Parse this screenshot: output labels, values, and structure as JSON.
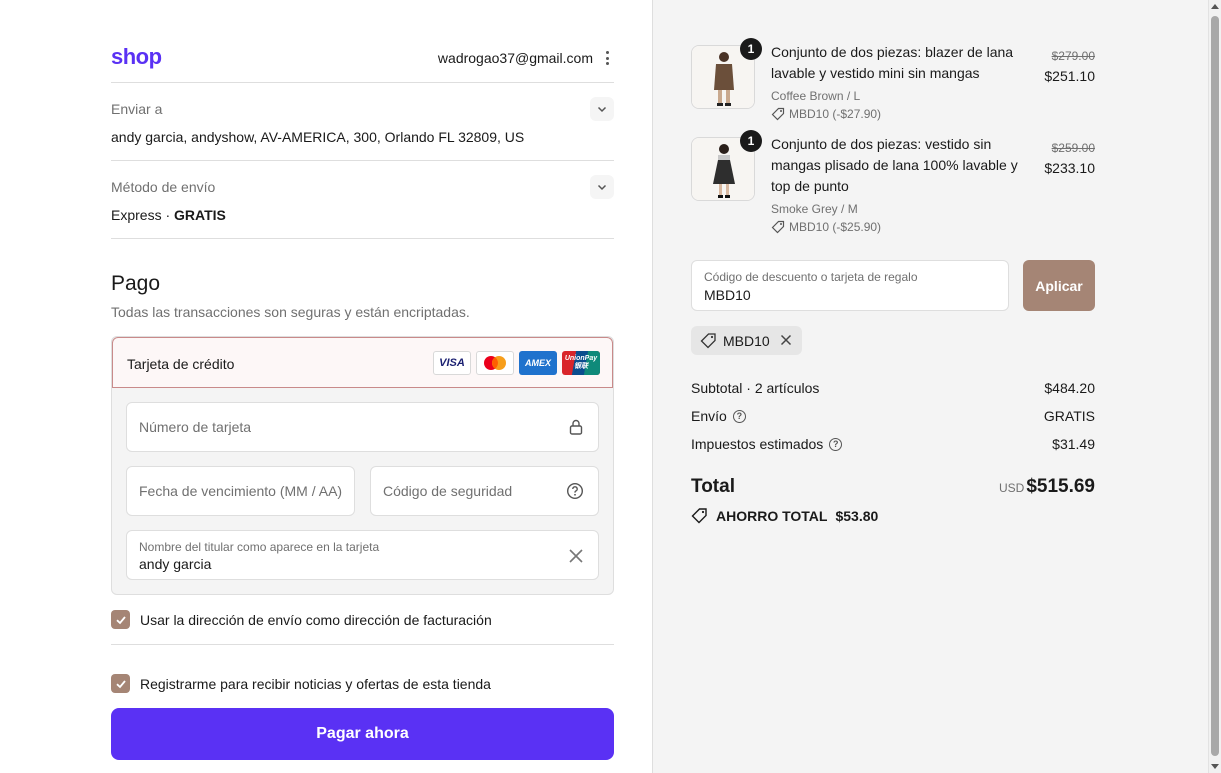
{
  "header": {
    "logo": "shop",
    "email": "wadrogao37@gmail.com"
  },
  "shipping_to": {
    "label": "Enviar a",
    "value": "andy garcia, andyshow, AV-AMERICA, 300, Orlando FL 32809, US"
  },
  "shipping_method": {
    "label": "Método de envío",
    "method": "Express · ",
    "price": "GRATIS"
  },
  "payment": {
    "title": "Pago",
    "subtitle": "Todas las transacciones son seguras y están encriptadas.",
    "option_label": "Tarjeta de crédito",
    "brands": [
      "VISA",
      "Mastercard",
      "AMEX",
      "UnionPay"
    ],
    "card_number_placeholder": "Número de tarjeta",
    "expiry_placeholder": "Fecha de vencimiento (MM / AA)",
    "cvv_placeholder": "Código de seguridad",
    "name_label": "Nombre del titular como aparece en la tarjeta",
    "name_value": "andy garcia"
  },
  "checkboxes": {
    "billing_same": "Usar la dirección de envío como dirección de facturación",
    "newsletter": "Registrarme para recibir noticias y ofertas de esta tienda"
  },
  "pay_button": "Pagar ahora",
  "items": [
    {
      "qty": "1",
      "title": "Conjunto de dos piezas: blazer de lana lavable y vestido mini sin mangas",
      "variant": "Coffee Brown / L",
      "discount": "MBD10 (-$27.90)",
      "old_price": "$279.00",
      "price": "$251.10",
      "image_color": "#6b4f3a"
    },
    {
      "qty": "1",
      "title": "Conjunto de dos piezas: vestido sin mangas plisado de lana 100% lavable y top de punto",
      "variant": "Smoke Grey / M",
      "discount": "MBD10 (-$25.90)",
      "old_price": "$259.00",
      "price": "$233.10",
      "image_color": "#2e2e2e"
    }
  ],
  "discount": {
    "label": "Código de descuento o tarjeta de regalo",
    "value": "MBD10",
    "apply": "Aplicar",
    "chip": "MBD10"
  },
  "summary": {
    "subtotal_label": "Subtotal · 2 artículos",
    "subtotal": "$484.20",
    "shipping_label": "Envío",
    "shipping": "GRATIS",
    "taxes_label": "Impuestos estimados",
    "taxes": "$31.49",
    "total_label": "Total",
    "currency": "USD",
    "total": "$515.69",
    "savings_label": "AHORRO TOTAL",
    "savings": "$53.80"
  },
  "colors": {
    "brand": "#5a31f4",
    "accent": "#a58575"
  }
}
